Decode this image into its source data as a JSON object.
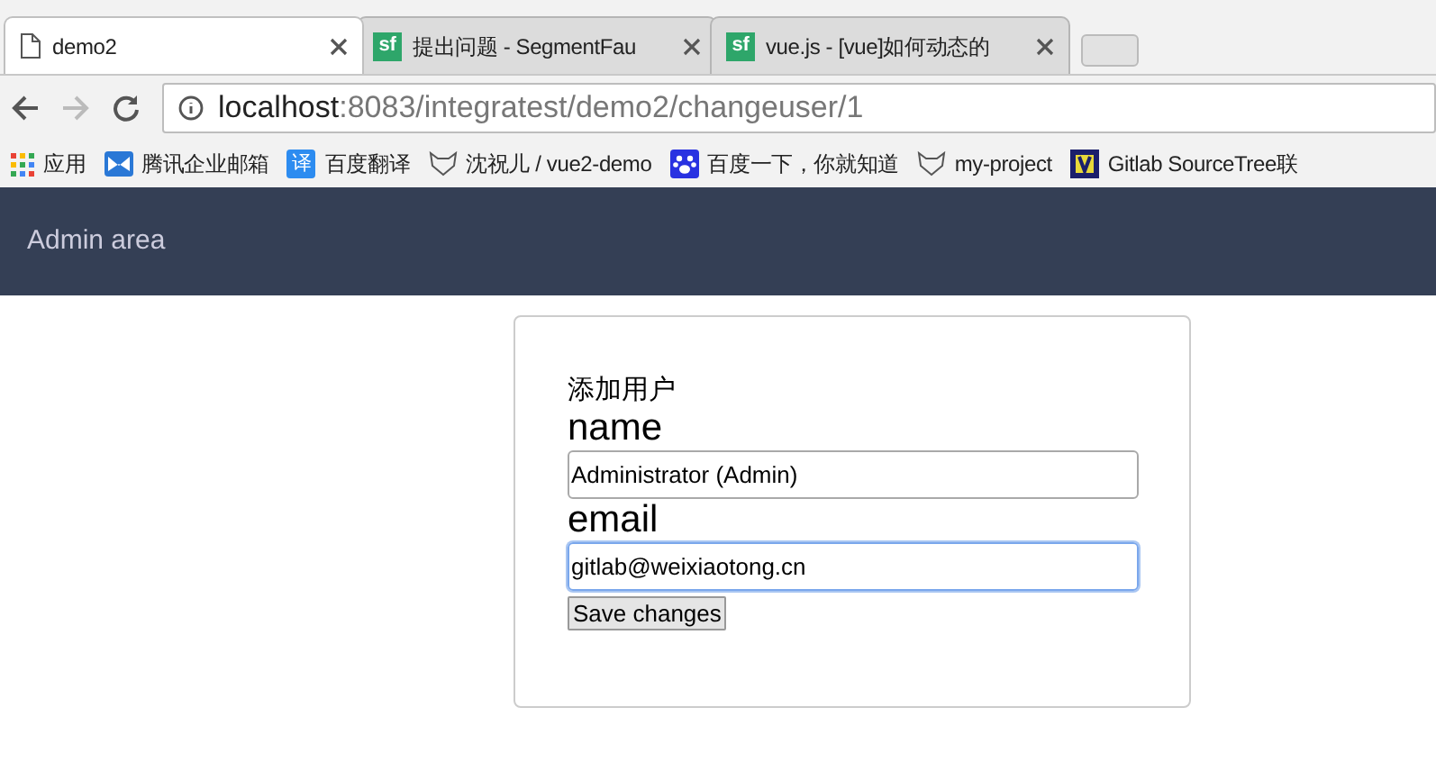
{
  "tabs": [
    {
      "kind": "page",
      "title": "demo2",
      "selected": true
    },
    {
      "kind": "sf",
      "title": "提出问题 - SegmentFau",
      "selected": false
    },
    {
      "kind": "sf",
      "title": "vue.js - [vue]如何动态的",
      "selected": false
    }
  ],
  "address": {
    "host": "localhost",
    "path": ":8083/integratest/demo2/changeuser/1"
  },
  "bookmarks": [
    {
      "kind": "apps",
      "label": "应用"
    },
    {
      "kind": "mail",
      "label": "腾讯企业邮箱"
    },
    {
      "kind": "translate",
      "label": "百度翻译",
      "glyph": "译"
    },
    {
      "kind": "fox",
      "label": "沈祝儿 / vue2-demo"
    },
    {
      "kind": "paw",
      "label": "百度一下，你就知道"
    },
    {
      "kind": "fox",
      "label": "my-project"
    },
    {
      "kind": "logo",
      "label": "Gitlab SourceTree联"
    }
  ],
  "navbar": {
    "brand": "Admin area"
  },
  "form": {
    "heading": "添加用户",
    "fields": [
      {
        "label": "name",
        "value": "Administrator (Admin)",
        "focused": false
      },
      {
        "label": "email",
        "value": "gitlab@weixiaotong.cn",
        "focused": true
      }
    ],
    "button": "Save changes"
  }
}
